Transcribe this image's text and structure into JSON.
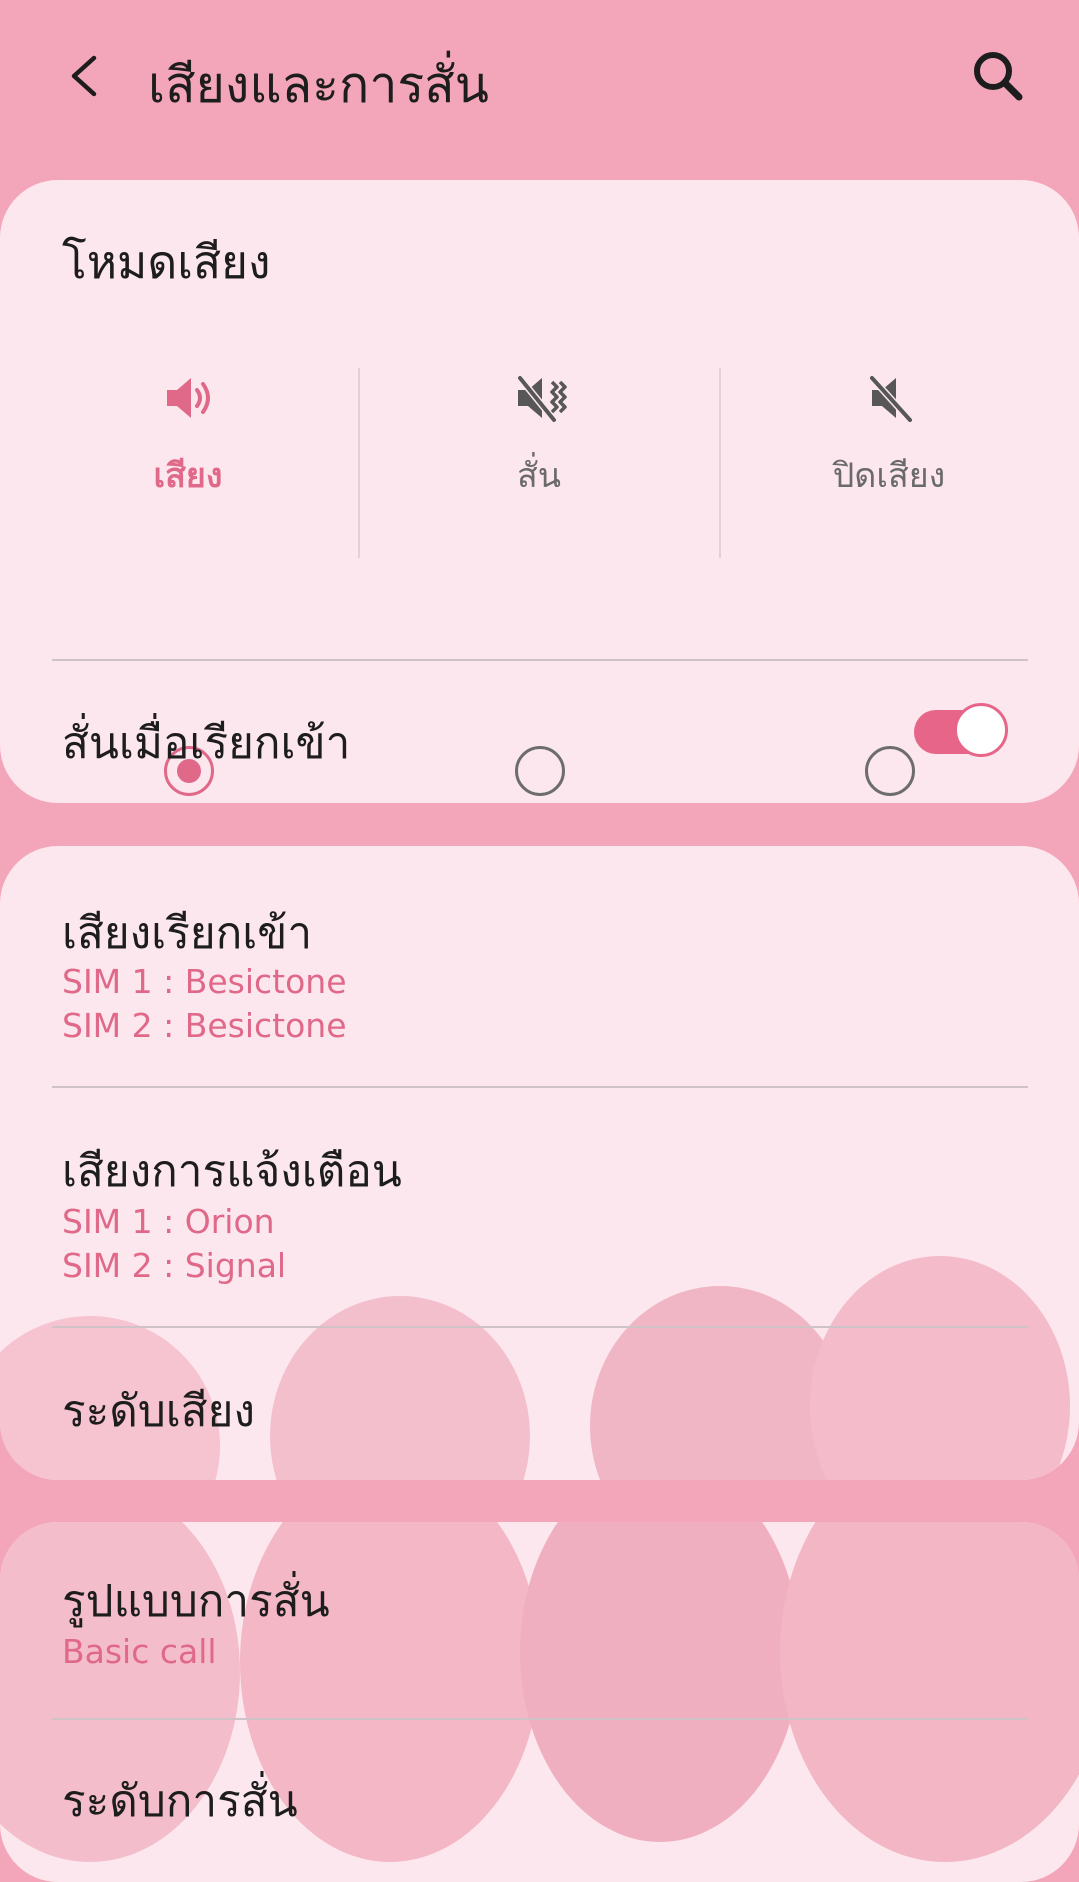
{
  "header": {
    "title": "เสียงและการสั่น",
    "back_icon": "chevron-left-icon",
    "search_icon": "search-icon"
  },
  "sound_mode": {
    "title": "โหมดเสียง",
    "options": [
      {
        "label": "เสียง",
        "icon": "speaker-icon",
        "selected": true
      },
      {
        "label": "สั่น",
        "icon": "vibrate-icon",
        "selected": false
      },
      {
        "label": "ปิดเสียง",
        "icon": "mute-icon",
        "selected": false
      }
    ],
    "vibrate_on_call": {
      "label": "สั่นเมื่อเรียกเข้า",
      "enabled": true
    }
  },
  "ringtone": {
    "title": "เสียงเรียกเข้า",
    "sim1": "SIM 1 : Besictone",
    "sim2": "SIM 2 : Besictone"
  },
  "notification_sound": {
    "title": "เสียงการแจ้งเตือน",
    "sim1": "SIM 1 : Orion",
    "sim2": "SIM 2 : Signal"
  },
  "volume": {
    "title": "ระดับเสียง"
  },
  "vibration_pattern": {
    "title": "รูปแบบการสั่น",
    "value": "Basic call"
  },
  "vibration_intensity": {
    "title": "ระดับการสั่น"
  },
  "colors": {
    "background": "#f3a6b9",
    "card": "#fde7ee",
    "accent": "#e06889"
  }
}
